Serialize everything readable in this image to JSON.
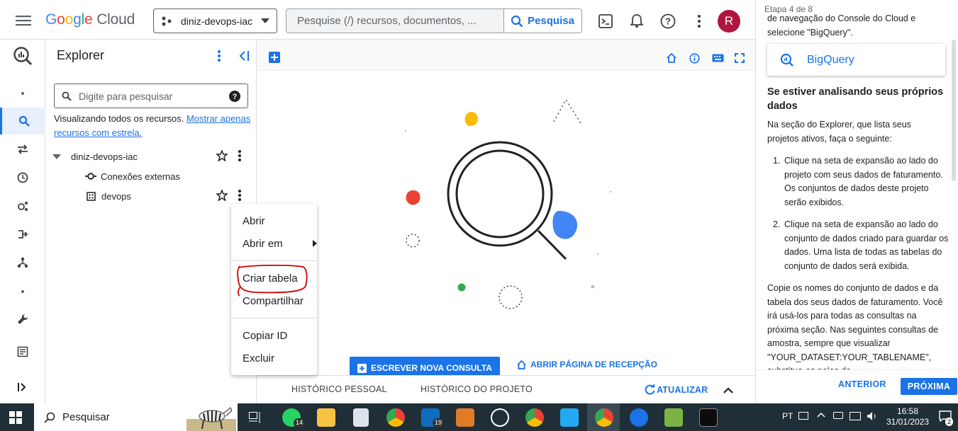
{
  "header": {
    "logo": {
      "google": "Google",
      "cloud": "Cloud"
    },
    "project": "diniz-devops-iac",
    "search_placeholder": "Pesquise (/) recursos, documentos, ...",
    "search_button": "Pesquisa",
    "avatar_letter": "R"
  },
  "explorer": {
    "title": "Explorer",
    "search_placeholder": "Digite para pesquisar",
    "info_text": "Visualizando todos os recursos.",
    "info_link": "Mostrar apenas recursos com estrela.",
    "tree": {
      "project": "diniz-devops-iac",
      "external": "Conexões externas",
      "dataset": "devops"
    }
  },
  "context_menu": {
    "items": [
      "Abrir",
      "Abrir em",
      "Criar tabela",
      "Compartilhar",
      "Copiar ID",
      "Excluir"
    ]
  },
  "main": {
    "new_query_button": "ESCREVER NOVA CONSULTA",
    "welcome_button": "ABRIR PÁGINA DE RECEPÇÃO",
    "tabs": [
      "HISTÓRICO PESSOAL",
      "HISTÓRICO DO PROJETO"
    ],
    "refresh": "ATUALIZAR"
  },
  "tutorial": {
    "step": "Etapa 4 de 8",
    "intro": "de navegação do Console do Cloud e selecione \"BigQuery\".",
    "card_label": "BigQuery",
    "heading": "Se estiver analisando seus próprios dados",
    "para1": "Na seção do Explorer, que lista seus projetos ativos, faça o seguinte:",
    "list": [
      "Clique na seta de expansão ao lado do projeto com seus dados de faturamento. Os conjuntos de dados deste projeto serão exibidos.",
      "Clique na seta de expansão ao lado do conjunto de dados criado para guardar os dados. Uma lista de todas as tabelas do conjunto de dados será exibida."
    ],
    "para2": "Copie os nomes do conjunto de dados e da tabela dos seus dados de faturamento. Você irá usá-los para todas as consultas na próxima seção. Nas seguintes consultas de amostra, sempre que visualizar \"YOUR_DATASET:YOUR_TABLENAME\", substitua-os pelos da...",
    "prev": "ANTERIOR",
    "next": "PRÓXIMA"
  },
  "taskbar": {
    "search": "Pesquisar",
    "badges": [
      "14",
      "19"
    ],
    "lang": "PT",
    "time": "16:58",
    "date": "31/01/2023",
    "notif_count": "2"
  },
  "colors": {
    "blue": "#1a73e8",
    "red": "#ea4335",
    "yellow": "#fbbc04",
    "green": "#34a853",
    "annotation": "#d10000"
  }
}
